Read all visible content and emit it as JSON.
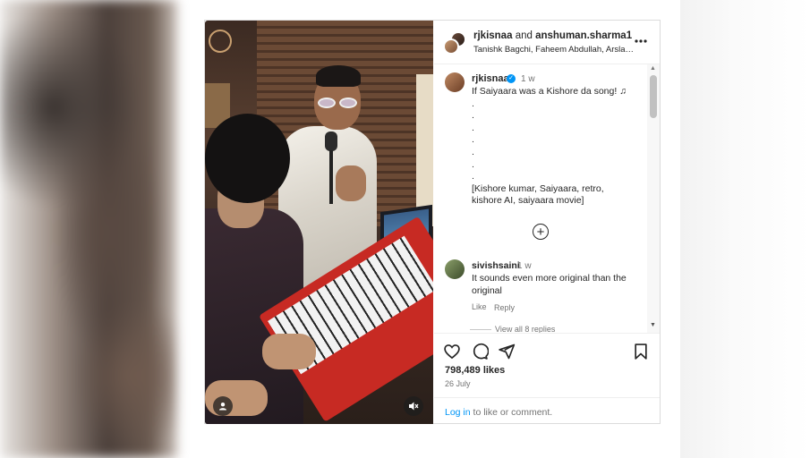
{
  "header": {
    "user1": "rjkisnaa",
    "and": "and",
    "user2": "anshuman.sharma1",
    "subtitle": "Tanishk Bagchi, Faheem Abdullah, Arslan ..."
  },
  "caption": {
    "username": "rjkisnaa",
    "time": "1 w",
    "text": "If Saiyaara was a Kishore da song! ♫\n.\n.\n.\n.\n.\n.\n.\n[Kishore kumar, Saiyaara, retro, kishore AI, saiyaara movie]"
  },
  "comment": {
    "username": "sivishsaini",
    "time": "1 w",
    "text": "It sounds even more original than the original",
    "like_label": "Like",
    "reply_label": "Reply",
    "view_replies": "View all 8 replies"
  },
  "post": {
    "likes": "798,489 likes",
    "date": "26 July"
  },
  "footer": {
    "login_link": "Log in",
    "login_rest": " to like or comment."
  },
  "icons": {
    "more": "more-options-icon",
    "heart": "heart-icon",
    "comment": "comment-icon",
    "share": "share-icon",
    "save": "bookmark-icon",
    "add": "plus-circle-icon",
    "user": "user-tag-icon",
    "mute": "mute-icon"
  },
  "colors": {
    "link": "#0095f6",
    "verified": "#0095f6",
    "muted_text": "#737373"
  }
}
